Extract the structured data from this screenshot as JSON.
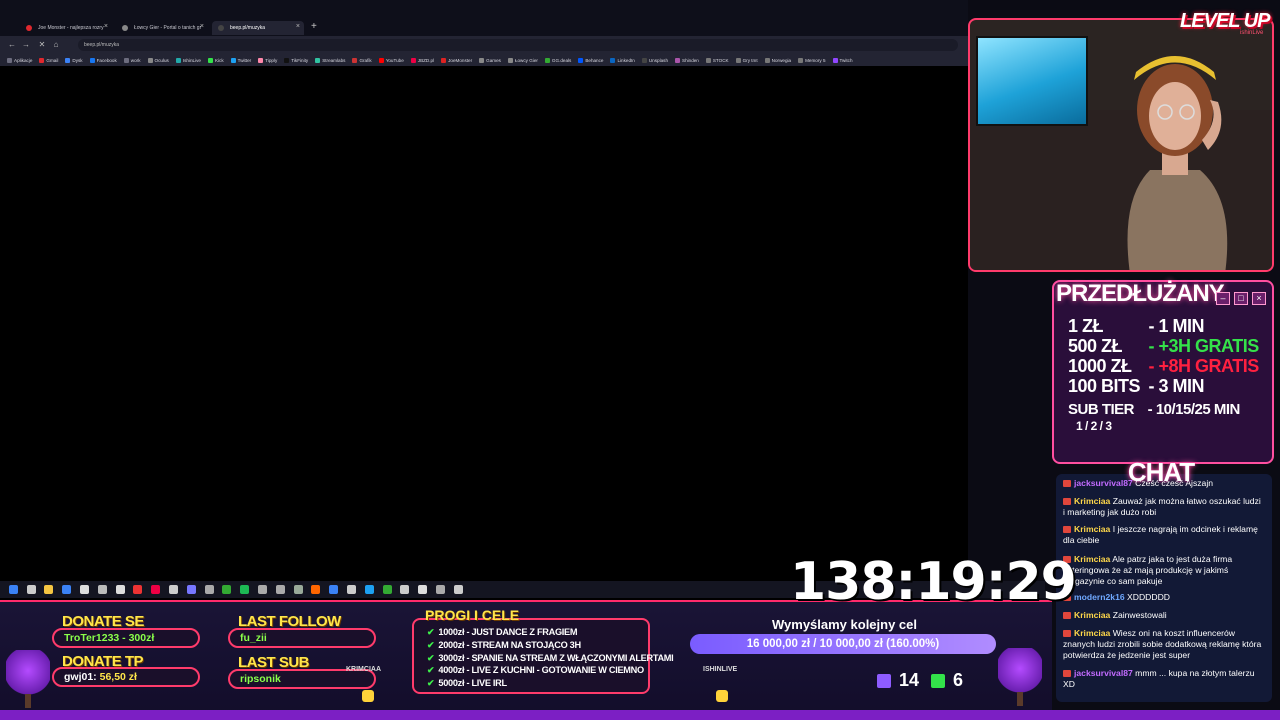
{
  "browser": {
    "tabs": [
      {
        "label": "Joe Monster - najlepsza rozry"
      },
      {
        "label": "Łowcy Gier - Portal o tanich gr"
      },
      {
        "label": "beep.pl/muzyka"
      }
    ],
    "new_tab": "+",
    "url": "beep.pl/muzyka",
    "nav": {
      "back": "←",
      "forward": "→",
      "reload": "✕",
      "home": "⌂"
    },
    "bookmarks": [
      "Aplikacje",
      "Gmail",
      "Dysk",
      "Facebook",
      "work",
      "Oculus",
      "IshinLive",
      "Kick",
      "Twitter",
      "Tipply",
      "TikFinity",
      "Streamlabs",
      "Grafik",
      "YouTube",
      "JBZD.pl",
      "JoeMonster",
      "Games",
      "Łowcy Gier",
      "GG.deals",
      "Behance",
      "LinkedIn",
      "Unsplash",
      "Shinden",
      "STOCK",
      "Gry tmt",
      "Norwegia",
      "Memory 5",
      "Twitch"
    ]
  },
  "overlay": {
    "brand": "LEVEL UP",
    "brand_sub": "ishinLive",
    "extension": {
      "title": "PRZEDŁUŻANY",
      "rows": [
        {
          "amount": "1 ZŁ",
          "time": "- 1 MIN",
          "style": "normal"
        },
        {
          "amount": "500 ZŁ",
          "time": "- +3H GRATIS",
          "style": "green"
        },
        {
          "amount": "1000 ZŁ",
          "time": "- +8H GRATIS",
          "style": "red"
        },
        {
          "amount": "100 BITS",
          "time": "- 3 MIN",
          "style": "normal"
        },
        {
          "amount": "SUB TIER",
          "time": "- 10/15/25 MIN",
          "style": "tier"
        }
      ],
      "tier_sub": "1 / 2 / 3"
    },
    "chat": {
      "title": "CHAT",
      "messages": [
        {
          "user": "jacksurvival87",
          "text": " Cześć cześć Ajszajn",
          "user_style": "purple"
        },
        {
          "user": "Krimciaa",
          "text": " Zauważ jak można łatwo oszukać ludzi i marketing jak dużo robi",
          "user_style": "yellow"
        },
        {
          "user": "Krimciaa",
          "text": " I jeszcze nagrają im odcinek i reklamę dla ciebie",
          "user_style": "yellow"
        },
        {
          "user": "Krimciaa",
          "text": " Ale patrz jaka to jest duża firma cateringowa że aż mają produkcję w jakimś magazynie co sam pakuje",
          "user_style": "yellow"
        },
        {
          "user": "modern2k16",
          "text": " XDDDDDD",
          "user_style": "blue"
        },
        {
          "user": "Krimciaa",
          "text": " Zainwestowali",
          "user_style": "yellow"
        },
        {
          "user": "Krimciaa",
          "text": " Wiesz oni na koszt influencerów znanych ludzi zrobili sobie dodatkową reklamę która potwierdza że jedzenie jest super",
          "user_style": "yellow"
        },
        {
          "user": "jacksurvival87",
          "text": " mmm ... kupa na złotym talerzu XD",
          "user_style": "purple"
        }
      ]
    },
    "donate_se": {
      "label": "DONATE SE",
      "value": "TroTer1233 - 300zł"
    },
    "donate_tp": {
      "label": "DONATE TP",
      "name": "gwj01:",
      "amount": "56,50 zł"
    },
    "last_follow": {
      "label": "LAST FOLLOW",
      "value": "fu_zii"
    },
    "last_sub": {
      "label": "LAST SUB",
      "value": "ripsonik"
    },
    "goals": {
      "title": "PROGI I CELE",
      "items": [
        "1000zł - JUST DANCE Z FRAGIEM",
        "2000zł - STREAM NA STOJĄCO 3H",
        "3000zł - SPANIE NA STREAM Z WŁĄCZONYMI ALERTAMI",
        "4000zł - LIVE Z KUCHNI - GOTOWANIE W CIEMNO",
        "5000zł - LIVE IRL"
      ]
    },
    "timer": "138:19:29",
    "goal": {
      "title": "Wymyślamy kolejny cel",
      "text": "16 000,00 zł / 10 000,00 zł (160.00%)",
      "progress_fraction": 1.0
    },
    "counts": {
      "twitch": "14",
      "kick": "6"
    },
    "sprite_labels": {
      "left": "KRIMCIAA",
      "right": "ISHINLIVE"
    }
  }
}
